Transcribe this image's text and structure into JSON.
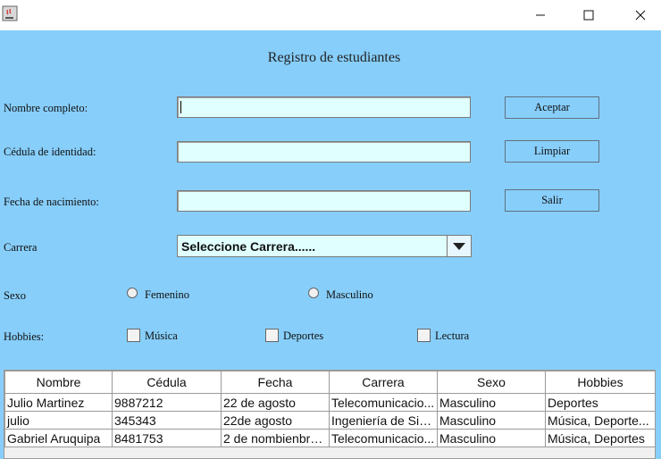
{
  "window": {
    "min_glyph": "—",
    "max_glyph": "☐",
    "close_glyph": "✕"
  },
  "form": {
    "title": "Registro de estudiantes",
    "labels": {
      "nombre": "Nombre completo:",
      "cedula": "Cédula de identidad:",
      "fecha": "Fecha de nacimiento:",
      "carrera": "Carrera",
      "sexo": "Sexo",
      "hobbies": "Hobbies:"
    },
    "inputs": {
      "nombre": "",
      "cedula": "",
      "fecha": ""
    },
    "buttons": {
      "aceptar": "Aceptar",
      "limpiar": "Limpiar",
      "salir": "Salir"
    },
    "carrera_selected": "Seleccione Carrera......",
    "sexo_options": [
      "Femenino",
      "Masculino"
    ],
    "hobbies_options": [
      "Música",
      "Deportes",
      "Lectura"
    ]
  },
  "table": {
    "headers": [
      "Nombre",
      "Cédula",
      "Fecha",
      "Carrera",
      "Sexo",
      "Hobbies"
    ],
    "rows": [
      [
        "Julio Martinez",
        "9887212",
        "22 de agosto",
        "Telecomunicacio...",
        "Masculino",
        "Deportes"
      ],
      [
        "julio",
        "345343",
        "22de agosto",
        "Ingeniería de Sist...",
        "Masculino",
        "Música, Deporte..."
      ],
      [
        "Gabriel Aruquipa",
        "8481753",
        "2 de nombienbre...",
        "Telecomunicacio...",
        "Masculino",
        "Música, Deportes"
      ]
    ]
  },
  "colors": {
    "background": "#87CEFA",
    "field_bg": "#E0FFFF"
  },
  "icons": {
    "app": "java-cup-icon",
    "combo": "triangle-down-icon"
  }
}
